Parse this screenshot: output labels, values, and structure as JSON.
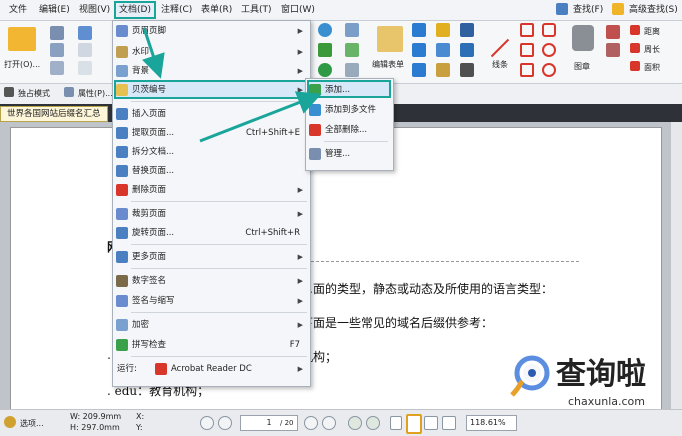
{
  "menubar": {
    "items": [
      "文件",
      "编辑(E)",
      "视图(V)",
      "文档(D)",
      "注释(C)",
      "表单(R)",
      "工具(T)",
      "窗口(W)"
    ],
    "right": [
      "查找(F)",
      "高级查找(S)"
    ]
  },
  "ribbon": {
    "open_label": "打开(O)...",
    "edit_form_label": "编辑表单",
    "line_label": "线条",
    "stamp_label": "图章",
    "distance_label": "距离",
    "perimeter_label": "周长",
    "area_label": "面积"
  },
  "toolbar2": {
    "exclusive_mode": "独占模式",
    "properties": "属性(P)..."
  },
  "doc_tab": "世界各国网站后缀名汇总",
  "document": {
    "line1": "…面的类型，静态或动态及所使用的语言类型：",
    "line2": "下面是一些常见的域名后缀供参考：",
    "line3": "…",
    "line4": "机构；",
    "line5": ". edu：教育机构；",
    "heading_char": "网"
  },
  "menu": {
    "items": [
      {
        "label": "页眉页脚",
        "arrow": true
      },
      {
        "label": "水印",
        "arrow": true
      },
      {
        "label": "背景",
        "arrow": true
      },
      {
        "label": "贝茨编号",
        "arrow": true
      },
      {
        "label": "插入页面",
        "shortcut": ""
      },
      {
        "label": "提取页面...",
        "shortcut": "Ctrl+Shift+E"
      },
      {
        "label": "拆分文档...",
        "shortcut": ""
      },
      {
        "label": "替换页面...",
        "shortcut": ""
      },
      {
        "label": "删除页面",
        "arrow": true
      },
      {
        "label": "裁剪页面",
        "arrow": true
      },
      {
        "label": "旋转页面...",
        "shortcut": "Ctrl+Shift+R"
      },
      {
        "label": "更多页面",
        "arrow": true
      },
      {
        "label": "数字签名",
        "arrow": true
      },
      {
        "label": "签名与缩写",
        "arrow": true
      },
      {
        "label": "加密",
        "arrow": true
      },
      {
        "label": "拼写检查",
        "shortcut": "F7"
      },
      {
        "label": "运行:",
        "extra": "Acrobat Reader DC",
        "arrow": true
      }
    ]
  },
  "submenu": {
    "items": [
      "添加...",
      "添加到多文件",
      "全部删除...",
      "管理..."
    ]
  },
  "statusbar": {
    "options": "选项...",
    "width": "W: 209.9mm",
    "height": "H: 297.0mm",
    "x_label": "X:",
    "y_label": "Y:",
    "page": "1",
    "page_total": "/ 20",
    "zoom": "118.61%"
  },
  "watermark": {
    "text": "查询啦",
    "url": "chaxunla.com"
  },
  "colors": {
    "highlight": "#19a59a",
    "menu_bg": "#f4f6f9",
    "accent_red": "#d9362b"
  }
}
